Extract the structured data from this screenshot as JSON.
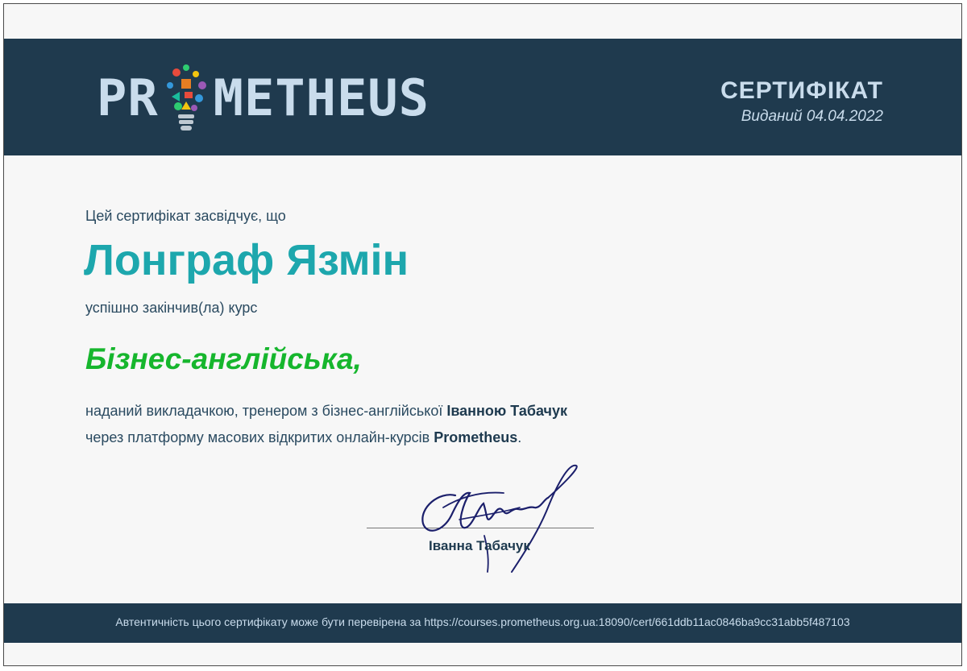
{
  "header": {
    "logo_left": "PR",
    "logo_right": "METHEUS",
    "title": "СЕРТИФІКАТ",
    "issued": "Виданий 04.04.2022"
  },
  "body": {
    "intro": "Цей сертифікат засвідчує, що",
    "recipient": "Лонграф Язмін",
    "completed": "успішно закінчив(ла) курс",
    "course": "Бізнес-англійська,",
    "desc_line1_prefix": "наданий викладачкою, тренером з бізнес-англійської ",
    "desc_line1_name": "Іванною Табачук",
    "desc_line2_prefix": "через платформу масових відкритих онлайн-курсів ",
    "desc_line2_platform": "Prometheus",
    "desc_line2_suffix": "."
  },
  "signature": {
    "signer": "Іванна Табачук"
  },
  "footer": {
    "verify": "Автентичність цього сертифікату може бути перевірена за https://courses.prometheus.org.ua:18090/cert/661ddb11ac0846ba9cc31abb5f487103"
  },
  "colors": {
    "header_bg": "#1f3a4e",
    "recipient": "#1da7ad",
    "course": "#16b62d"
  }
}
